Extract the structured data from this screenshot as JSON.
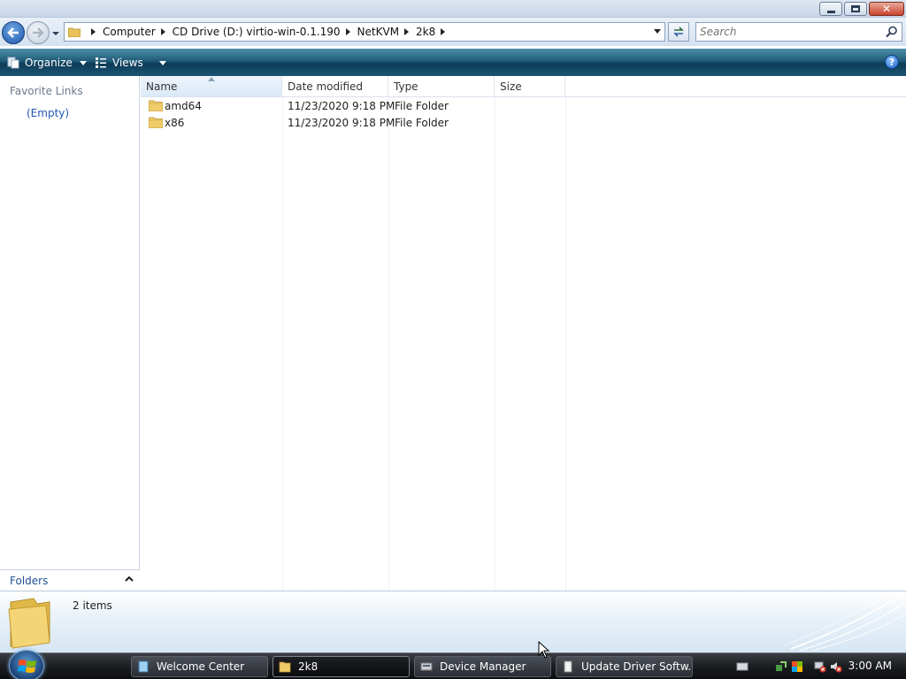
{
  "window": {
    "minimize_label": "",
    "maximize_label": "",
    "close_label": ""
  },
  "address": {
    "crumbs": [
      "Computer",
      "CD Drive (D:) virtio-win-0.1.190",
      "NetKVM",
      "2k8"
    ]
  },
  "search": {
    "placeholder": "Search"
  },
  "toolbar": {
    "organize_label": "Organize",
    "views_label": "Views",
    "help_label": "?"
  },
  "navigation": {
    "favorite_links_title": "Favorite Links",
    "favorite_links_empty": "(Empty)",
    "folders_label": "Folders"
  },
  "columns": {
    "name": "Name",
    "date_modified": "Date modified",
    "type": "Type",
    "size": "Size"
  },
  "files": [
    {
      "name": "amd64",
      "date_modified": "11/23/2020 9:18 PM",
      "type": "File Folder",
      "size": ""
    },
    {
      "name": "x86",
      "date_modified": "11/23/2020 9:18 PM",
      "type": "File Folder",
      "size": ""
    }
  ],
  "details": {
    "item_count": "2 items"
  },
  "taskbar": {
    "tasks": [
      {
        "label": "Welcome Center",
        "icon": "welcome-center-icon",
        "active": false
      },
      {
        "label": "2k8",
        "icon": "folder-icon",
        "active": true
      },
      {
        "label": "Device Manager",
        "icon": "device-manager-icon",
        "active": false
      },
      {
        "label": "Update Driver Softw...",
        "icon": "update-driver-icon",
        "active": false
      }
    ],
    "clock": "3:00 AM"
  },
  "colors": {
    "command_bar": "#1f5b78",
    "link_blue": "#2257b1",
    "taskbar": "#1b1d21"
  }
}
